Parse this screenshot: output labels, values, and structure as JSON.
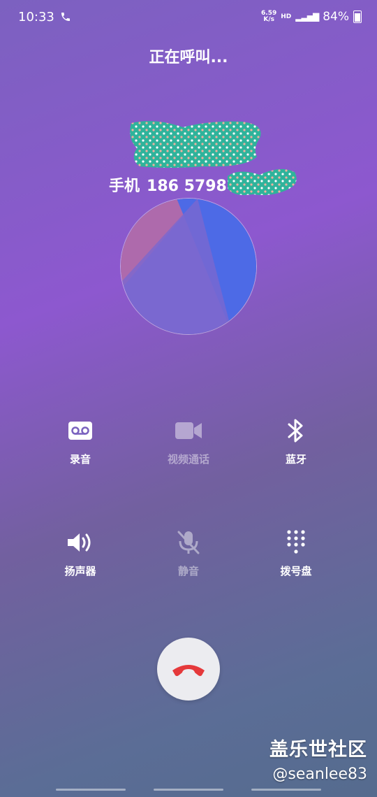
{
  "status_bar": {
    "time": "10:33",
    "speed_value": "6.59",
    "speed_unit": "K/s",
    "hd": "HD",
    "battery": "84%"
  },
  "call": {
    "status_text": "正在呼叫...",
    "number_type": "手机",
    "number_partial": "186 5798"
  },
  "actions": [
    {
      "label": "录音",
      "icon": "voicemail-icon",
      "enabled": true
    },
    {
      "label": "视频通话",
      "icon": "video-camera-icon",
      "enabled": false
    },
    {
      "label": "蓝牙",
      "icon": "bluetooth-icon",
      "enabled": true
    },
    {
      "label": "扬声器",
      "icon": "speaker-icon",
      "enabled": true
    },
    {
      "label": "静音",
      "icon": "mic-off-icon",
      "enabled": false
    },
    {
      "label": "拨号盘",
      "icon": "dialpad-icon",
      "enabled": true
    }
  ],
  "end_call": {
    "icon": "end-call-icon",
    "color": "#e5393b"
  },
  "watermark": {
    "line1": "盖乐世社区",
    "line2": "@seanlee83"
  },
  "colors": {
    "bg_top": "#8d58cf",
    "bg_bottom": "#556b8e",
    "end_call_bg": "#ececf0"
  }
}
